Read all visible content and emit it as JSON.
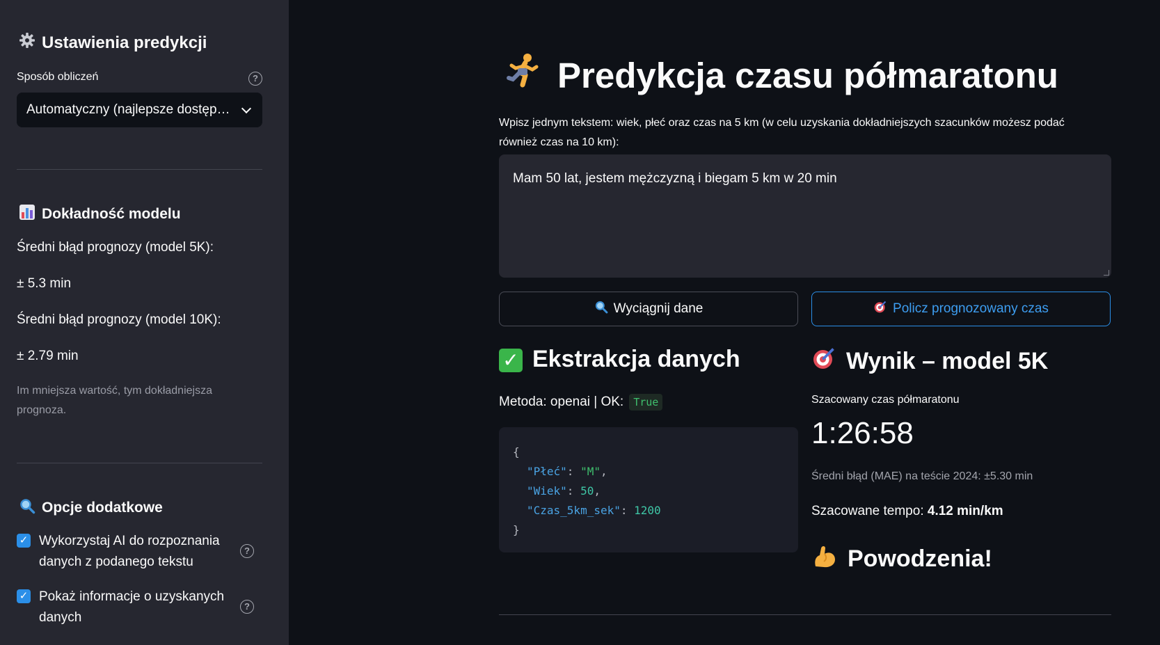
{
  "sidebar": {
    "settings_icon": "gear-icon",
    "settings_title": "Ustawienia predykcji",
    "method_label": "Sposób obliczeń",
    "method_value": "Automatyczny (najlepsze dostępne)",
    "accuracy_icon": "bar-chart-icon",
    "accuracy_title": "Dokładność modelu",
    "mae_5k_label": "Średni błąd prognozy (model 5K):",
    "mae_5k_value": "± 5.3 min",
    "mae_10k_label": "Średni błąd prognozy (model 10K):",
    "mae_10k_value": "± 2.79 min",
    "accuracy_note": "Im mniejsza wartość, tym dokładniejsza prognoza.",
    "extra_icon": "magnifier-icon",
    "extra_title": "Opcje dodatkowe",
    "option_ai_label": "Wykorzystaj AI do rozpoznania danych z podanego tekstu",
    "option_ai_checked": true,
    "option_info_label": "Pokaż informacje o uzyskanych danych",
    "option_info_checked": true
  },
  "main": {
    "title_icon": "runner-icon",
    "title": "Predykcja czasu półmaratonu",
    "instructions": "Wpisz jednym tekstem: wiek, płeć oraz czas na 5 km (w celu uzyskania dokładniejszych szacunków możesz podać również czas na 10 km):",
    "input_value": "Mam 50 lat, jestem mężczyzną i biegam 5 km w 20 min",
    "extract_button": "Wyciągnij dane",
    "predict_button": "Policz prognozowany czas",
    "extraction_title": "Ekstrakcja danych",
    "method_text": "Metoda: openai | OK:",
    "ok_value": "True",
    "json_open": "{",
    "json_close": "}",
    "json_fields": [
      {
        "key": "\"Płeć\"",
        "value": "\"M\"",
        "sep": ","
      },
      {
        "key": "\"Wiek\"",
        "value": "50",
        "sep": ","
      },
      {
        "key": "\"Czas_5km_sek\"",
        "value": "1200",
        "sep": ""
      }
    ],
    "result_title": "Wynik – model 5K",
    "estimated_label": "Szacowany czas półmaratonu",
    "estimated_time": "1:26:58",
    "mae_note": "Średni błąd (MAE) na teście 2024: ±5.30 min",
    "tempo_label": "Szacowane tempo:",
    "tempo_value": "4.12 min/km",
    "good_luck": "Powodzenia!"
  }
}
